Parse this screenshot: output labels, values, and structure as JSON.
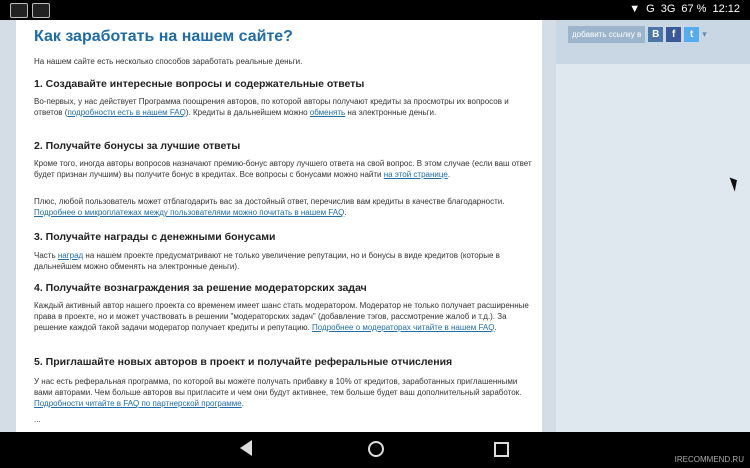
{
  "status_bar": {
    "signal": "G",
    "network": "3G",
    "battery": "67 %",
    "time": "12:12"
  },
  "sidebar": {
    "share_label": "добавить ссылку в",
    "vk": "В",
    "fb": "f",
    "tw": "t",
    "more": "▾"
  },
  "page": {
    "title": "Как заработать на нашем сайте?",
    "intro": "На нашем сайте есть несколько способов заработать реальные деньги.",
    "s1": {
      "heading": "1. Создавайте интересные вопросы и содержательные ответы",
      "t1": "Во-первых, у нас действует Программа поощрения авторов, по которой авторы получают кредиты за просмотры их  вопросов и ответов (",
      "l1": "подробности есть в нашем FAQ",
      "t2": "). Кредиты в дальнейшем можно ",
      "l2": "обменять",
      "t3": " на электронные деньги."
    },
    "s2": {
      "heading": "2. Получайте бонусы за лучшие ответы",
      "p1": "Кроме того, иногда авторы вопросов назначают премию-бонус автору лучшего ответа на свой вопрос. В этом случае (если ваш ответ будет признан лучшим) вы получите бонус в кредитах. Все вопросы с бонусами можно найти ",
      "l1": "на этой странице",
      "p1_end": ".",
      "p2": "Плюс, любой пользователь может отблагодарить вас за достойный ответ, перечислив вам кредиты в качестве благодарности. ",
      "l2": "Подробнее о микроплатежах между пользователями можно почитать в нашем FAQ",
      "p2_end": "."
    },
    "s3": {
      "heading": "3. Получайте награды с денежными бонусами",
      "t1": "Часть ",
      "l1": "наград",
      "t2": " на нашем проекте предусматривают не только увеличение репутации, но и бонусы в виде кредитов (которые в дальнейшем можно обменять на электронные деньги)."
    },
    "s4": {
      "heading": "4. Получайте вознаграждения за решение модераторских задач",
      "t1": "Каждый активный автор нашего проекта со временем имеет шанс стать модератором. Модератор не только получает расширенные права в проекте, но и может участвовать в решении \"модераторских задач\" (добавление тэгов, рассмотрение жалоб и т.д.). За решение каждой такой задачи модератор получает кредиты и репутацию. ",
      "l1": "Подробнее о модераторах читайте в нашем FAQ",
      "t2": "."
    },
    "s5": {
      "heading": "5. Приглашайте новых авторов в проект и получайте реферальные отчисления",
      "t1": "У нас есть реферальная программа, по которой вы можете получать прибавку в 10% от кредитов, заработанных приглашенными вами авторами. Чем больше авторов вы пригласите и чем они будут активнее, тем больше будет ваш дополнительный заработок. ",
      "l1": "Подробности читайте в FAQ по партнерской программе",
      "t2": "."
    },
    "ellipsis": "..."
  },
  "watermark": "IRECOMMEND.RU"
}
